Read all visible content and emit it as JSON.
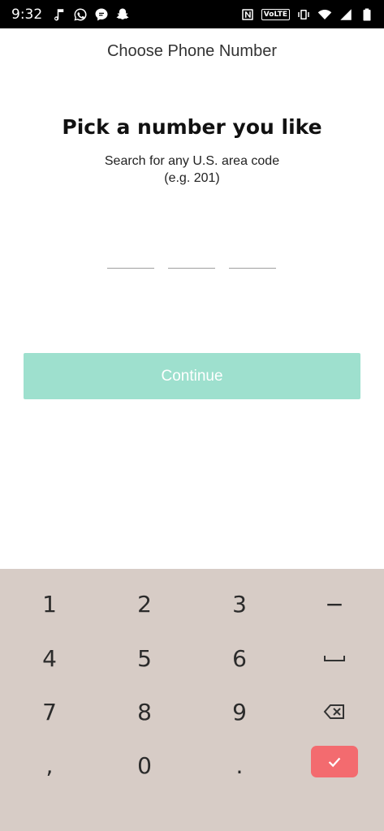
{
  "status_bar": {
    "time": "9:32",
    "volte_label": "VoLTE",
    "left_icons": [
      "music-note-icon",
      "whatsapp-icon",
      "chat-icon",
      "snapchat-icon"
    ],
    "right_icons": [
      "nfc-icon",
      "volte-icon",
      "vibrate-icon",
      "wifi-icon",
      "signal-icon",
      "battery-icon"
    ]
  },
  "header": {
    "title": "Choose Phone Number"
  },
  "main": {
    "heading": "Pick a number you like",
    "subtitle_line1": "Search for any U.S. area code",
    "subtitle_line2": "(e.g. 201)",
    "digits": [
      "",
      "",
      ""
    ],
    "continue_label": "Continue"
  },
  "keyboard": {
    "rows": [
      [
        "1",
        "2",
        "3",
        "−"
      ],
      [
        "4",
        "5",
        "6",
        "space"
      ],
      [
        "7",
        "8",
        "9",
        "backspace"
      ],
      [
        ",",
        "0",
        ".",
        "enter"
      ]
    ],
    "labels": {
      "k1": "1",
      "k2": "2",
      "k3": "3",
      "dash": "−",
      "k4": "4",
      "k5": "5",
      "k6": "6",
      "k7": "7",
      "k8": "8",
      "k9": "9",
      "comma": ",",
      "k0": "0",
      "period": "."
    }
  },
  "colors": {
    "accent_disabled": "#9ee0ce",
    "enter_key": "#f36b6f",
    "keyboard_bg": "#d7ccc6"
  }
}
